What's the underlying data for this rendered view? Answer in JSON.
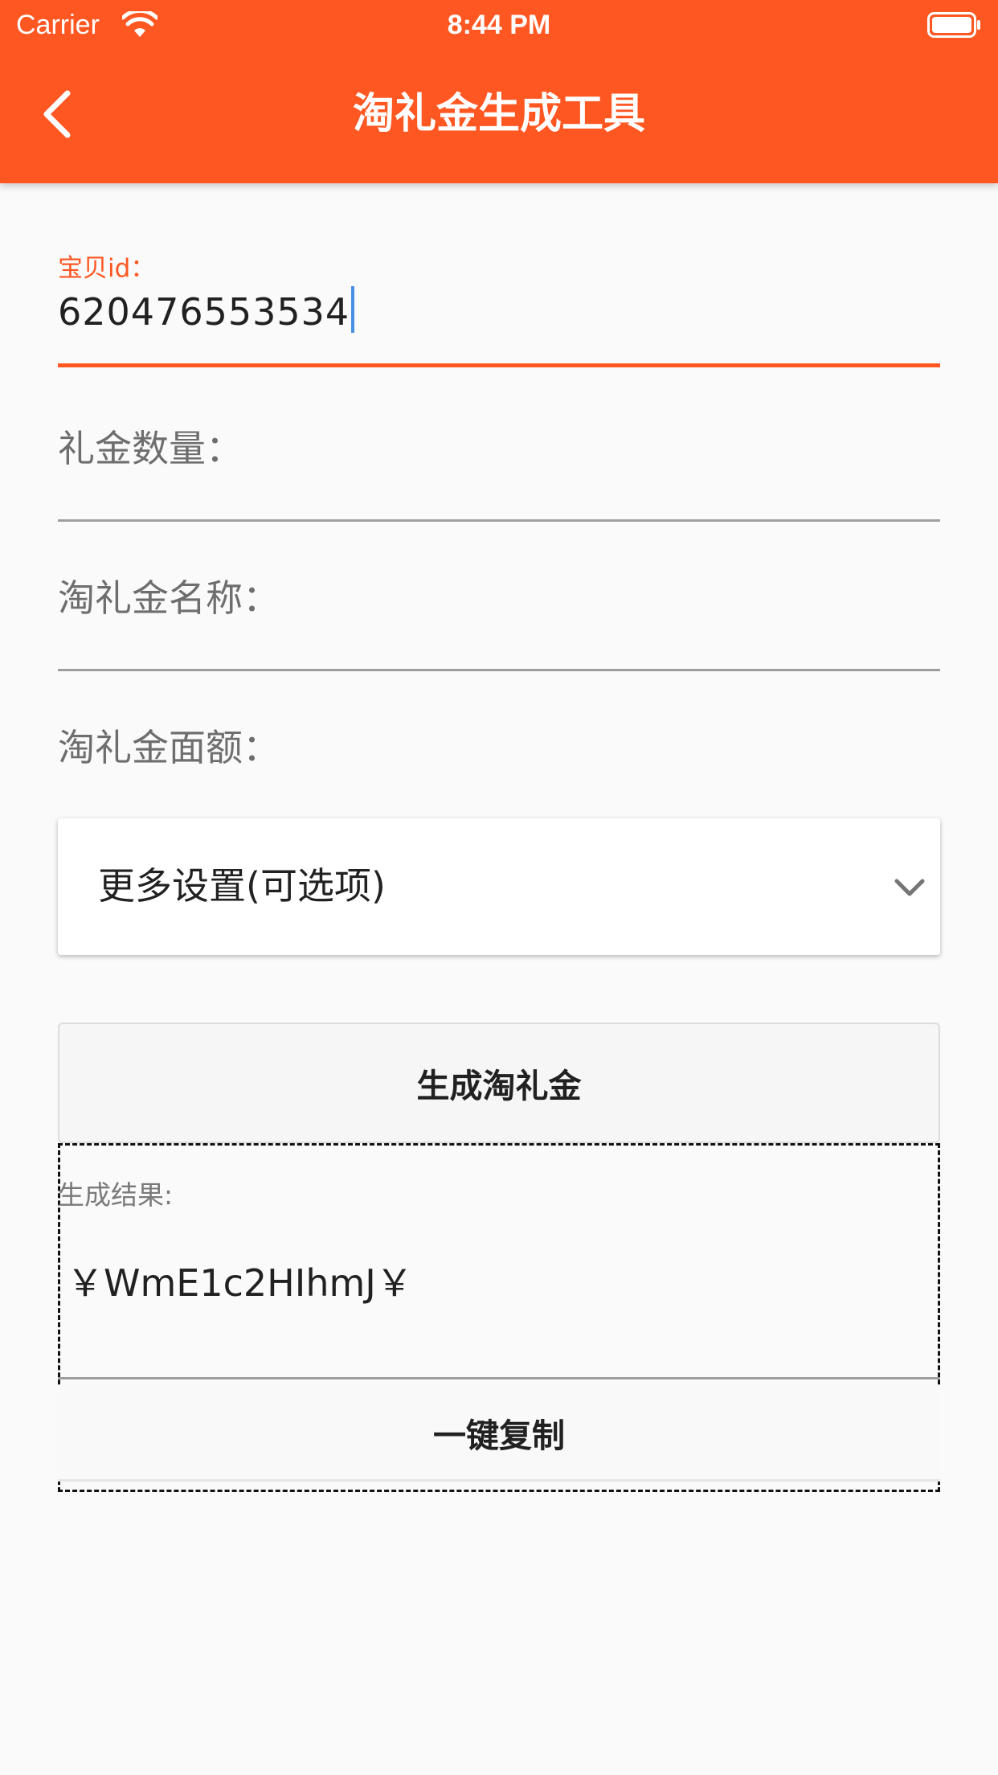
{
  "status_bar": {
    "carrier": "Carrier",
    "time": "8:44 PM"
  },
  "nav": {
    "title": "淘礼金生成工具",
    "back_icon": "chevron-left-icon"
  },
  "form": {
    "item_id": {
      "label": "宝贝id：",
      "value": "620476553534"
    },
    "quantity": {
      "label": "礼金数量："
    },
    "name": {
      "label": "淘礼金名称："
    },
    "face_value": {
      "label": "淘礼金面额："
    }
  },
  "more_settings": {
    "label": "更多设置(可选项)",
    "icon": "chevron-down-icon"
  },
  "generate_button": {
    "label": "生成淘礼金"
  },
  "result": {
    "label": "生成结果:",
    "value": "￥WmE1c2HIhmJ￥",
    "copy_label": "一键复制"
  },
  "colors": {
    "accent": "#ff5722",
    "background": "#fafafa"
  }
}
